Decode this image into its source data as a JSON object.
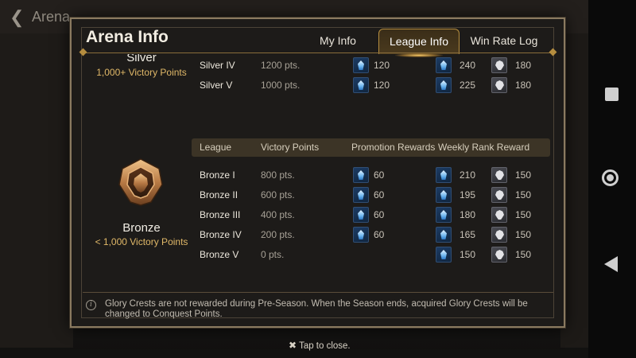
{
  "background": {
    "screen_title": "Arena"
  },
  "modal": {
    "title": "Arena Info",
    "tabs": [
      {
        "label": "My Info",
        "active": false
      },
      {
        "label": "League Info",
        "active": true
      },
      {
        "label": "Win Rate Log",
        "active": false
      }
    ],
    "columns": {
      "league": "League",
      "victory_points": "Victory Points",
      "promotion_rewards": "Promotion Rewards",
      "weekly_rank_reward": "Weekly Rank Reward"
    },
    "silver": {
      "name": "Silver",
      "requirement": "1,000+ Victory Points",
      "rows": [
        {
          "name": "Silver IV",
          "pts": "1200 pts.",
          "promo": "120",
          "weekly_crest": "240",
          "weekly_skull": "180"
        },
        {
          "name": "Silver V",
          "pts": "1000 pts.",
          "promo": "120",
          "weekly_crest": "225",
          "weekly_skull": "180"
        }
      ]
    },
    "bronze": {
      "name": "Bronze",
      "requirement": "< 1,000 Victory Points",
      "rows": [
        {
          "name": "Bronze I",
          "pts": "800 pts.",
          "promo": "60",
          "weekly_crest": "210",
          "weekly_skull": "150"
        },
        {
          "name": "Bronze II",
          "pts": "600 pts.",
          "promo": "60",
          "weekly_crest": "195",
          "weekly_skull": "150"
        },
        {
          "name": "Bronze III",
          "pts": "400 pts.",
          "promo": "60",
          "weekly_crest": "180",
          "weekly_skull": "150"
        },
        {
          "name": "Bronze IV",
          "pts": "200 pts.",
          "promo": "60",
          "weekly_crest": "165",
          "weekly_skull": "150"
        },
        {
          "name": "Bronze V",
          "pts": "0 pts.",
          "promo": "",
          "weekly_crest": "150",
          "weekly_skull": "150"
        }
      ]
    },
    "footer_note": "Glory Crests are not rewarded during Pre-Season. When the Season ends, acquired Glory Crests will be changed to Conquest Points."
  },
  "tap_to_close": "Tap to close.",
  "icons": {
    "promotion_reward": "glory-crest-icon",
    "weekly_reward_secondary": "skull-emblem-icon",
    "league_badge": "bronze-badge-icon"
  },
  "colors": {
    "accent_gold": "#b58d3f",
    "requirement_text": "#e0b868",
    "header_bar": "#3c3426"
  }
}
